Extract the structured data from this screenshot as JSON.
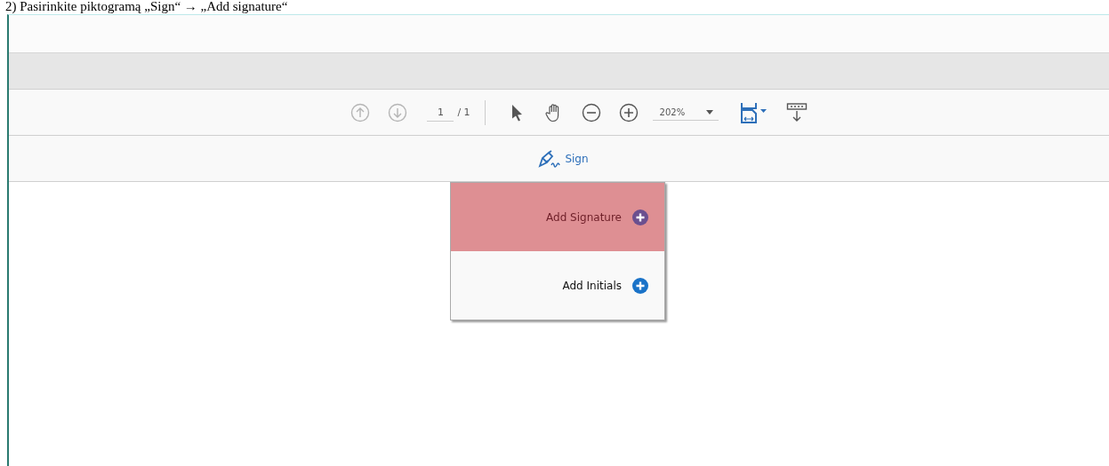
{
  "caption": "2) Pasirinkite piktogramą „Sign“ → „Add signature“",
  "toolbar": {
    "prev_page": {
      "disabled": true
    },
    "next_page": {
      "disabled": true
    },
    "page_field": "1",
    "page_total": "/ 1",
    "zoom": "202%"
  },
  "sign_button": {
    "label": "Sign"
  },
  "menu": [
    {
      "label": "Add Signature",
      "selected": true
    },
    {
      "label": "Add Initials",
      "selected": false
    }
  ]
}
